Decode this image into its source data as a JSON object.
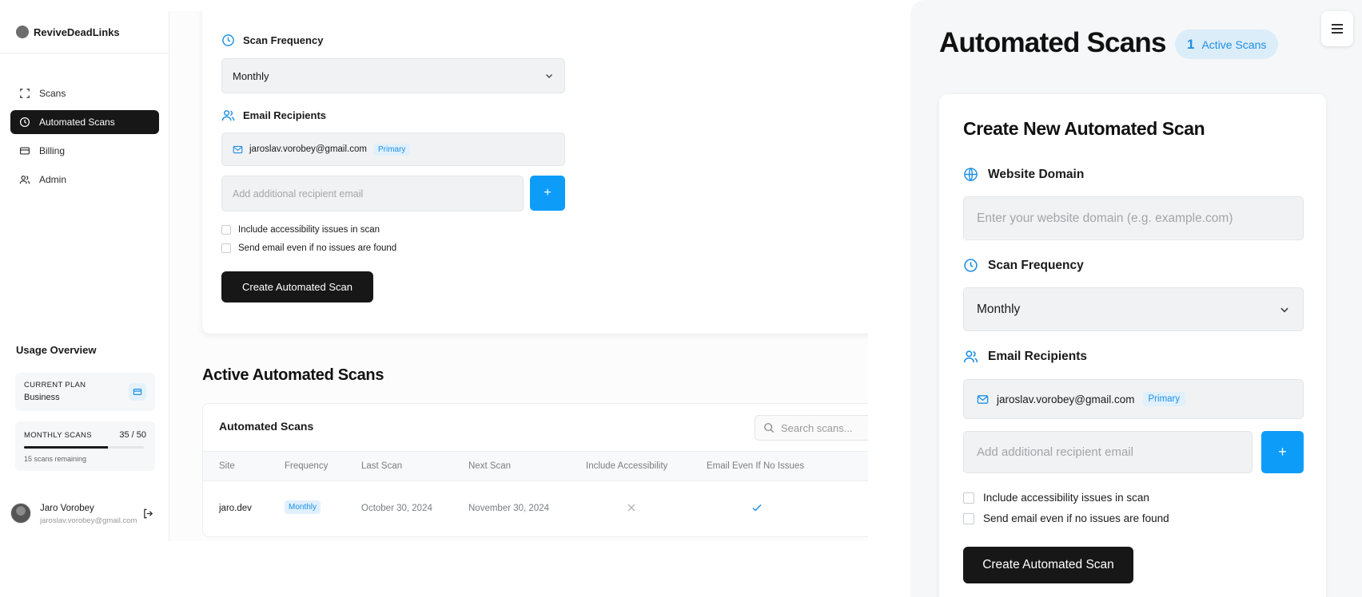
{
  "brand": "ReviveDeadLinks",
  "nav": [
    {
      "label": "Scans",
      "icon": "scan-icon"
    },
    {
      "label": "Automated Scans",
      "icon": "clock-icon"
    },
    {
      "label": "Billing",
      "icon": "card-icon"
    },
    {
      "label": "Admin",
      "icon": "users-icon"
    }
  ],
  "usage": {
    "title": "Usage Overview",
    "plan_label": "CURRENT PLAN",
    "plan_value": "Business",
    "scans_label": "MONTHLY SCANS",
    "scans_count": "35 / 50",
    "scans_progress": 0.7,
    "scans_remaining": "15 scans remaining"
  },
  "user": {
    "name": "Jaro Vorobey",
    "email": "jaroslav.vorobey@gmail.com"
  },
  "form": {
    "frequency_label": "Scan Frequency",
    "frequency_value": "Monthly",
    "recipients_label": "Email Recipients",
    "primary_email": "jaroslav.vorobey@gmail.com",
    "primary_badge": "Primary",
    "add_placeholder": "Add additional recipient email",
    "add_button": "+",
    "option_accessibility": "Include accessibility issues in scan",
    "option_send_anyway": "Send email even if no issues are found",
    "submit_label": "Create Automated Scan"
  },
  "active_section": {
    "title": "Active Automated Scans",
    "table_title": "Automated Scans",
    "search_placeholder": "Search scans...",
    "columns": [
      "Site",
      "Frequency",
      "Last Scan",
      "Next Scan",
      "Include Accessibility",
      "Email Even If No Issues"
    ],
    "rows": [
      {
        "site": "jaro.dev",
        "frequency": "Monthly",
        "last_scan": "October 30, 2024",
        "next_scan": "November 30, 2024",
        "include_accessibility": false,
        "email_even_if_no_issues": true
      }
    ]
  },
  "mobile": {
    "title": "Automated Scans",
    "active_count": "1",
    "active_label": "Active Scans",
    "card_title": "Create New Automated Scan",
    "domain_label": "Website Domain",
    "domain_placeholder": "Enter your website domain (e.g. example.com)",
    "frequency_label": "Scan Frequency",
    "frequency_value": "Monthly",
    "recipients_label": "Email Recipients",
    "primary_email": "jaroslav.vorobey@gmail.com",
    "primary_badge": "Primary",
    "add_placeholder": "Add additional recipient email",
    "add_button": "+",
    "option_accessibility": "Include accessibility issues in scan",
    "option_send_anyway": "Send email even if no issues are found",
    "submit_label": "Create Automated Scan"
  },
  "colors": {
    "accent": "#0e9cf9",
    "dark": "#171717",
    "badge_bg": "#e0f0fd",
    "badge_text": "#1d8fe6"
  }
}
